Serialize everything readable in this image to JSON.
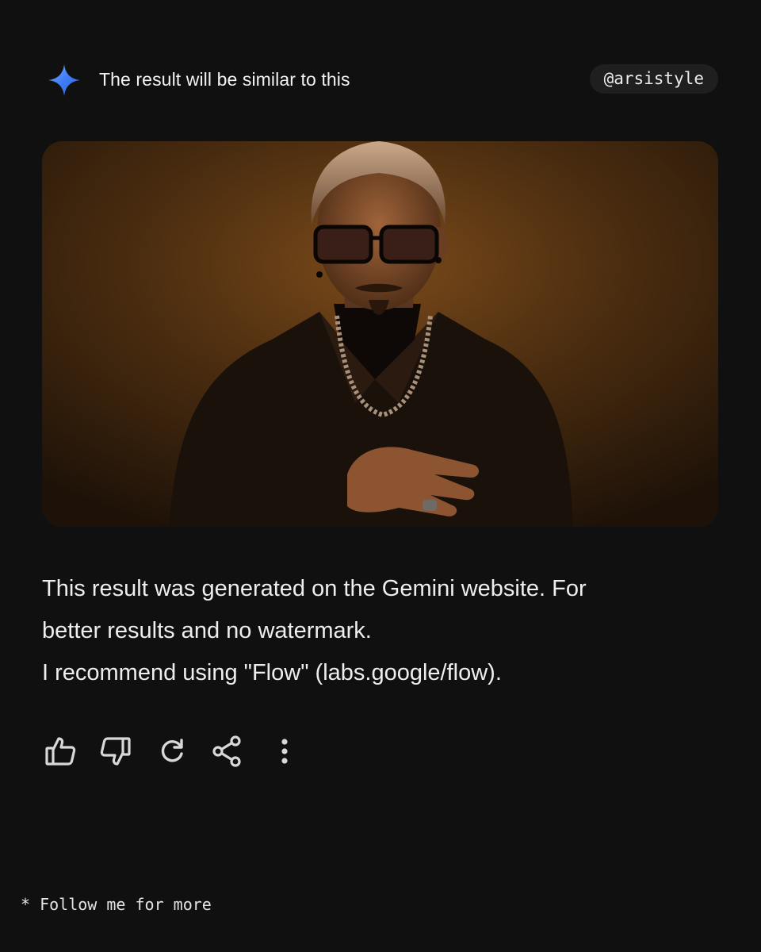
{
  "header": {
    "icon": "gemini-sparkle-icon",
    "title": "The result will be similar to this",
    "handle": "@arsistyle"
  },
  "result_image": {
    "description_icon": "generated-portrait-image"
  },
  "message": {
    "line1": "This result was generated on the Gemini website. For",
    "line2": "better results and no watermark.",
    "line3": "I recommend using \"Flow\" (labs.google/flow)."
  },
  "actions": [
    {
      "icon": "thumbs-up-icon"
    },
    {
      "icon": "thumbs-down-icon"
    },
    {
      "icon": "regenerate-icon"
    },
    {
      "icon": "share-icon"
    },
    {
      "icon": "more-vert-icon"
    }
  ],
  "footer": {
    "note": "* Follow me for more"
  },
  "colors": {
    "background": "#101010",
    "accent_blue": "#4a86f7",
    "badge": "#1f1f1f"
  }
}
